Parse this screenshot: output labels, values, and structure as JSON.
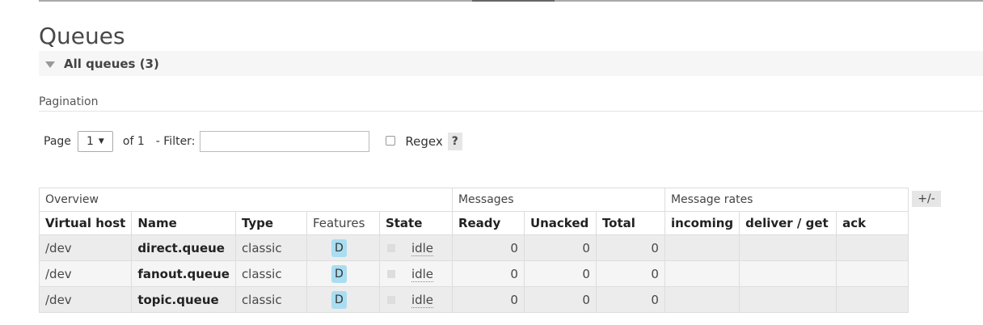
{
  "title": "Queues",
  "section": {
    "label": "All queues (3)"
  },
  "pagination": {
    "label": "Pagination",
    "page_label": "Page",
    "page_value": "1",
    "of_label": "of 1",
    "filter_label": "- Filter:",
    "filter_value": "",
    "regex_label": "Regex",
    "help_label": "?"
  },
  "table": {
    "groups": [
      "Overview",
      "Messages",
      "Message rates"
    ],
    "columns": [
      "Virtual host",
      "Name",
      "Type",
      "Features",
      "State",
      "Ready",
      "Unacked",
      "Total",
      "incoming",
      "deliver / get",
      "ack"
    ],
    "rows": [
      {
        "vhost": "/dev",
        "name": "direct.queue",
        "type": "classic",
        "feature": "D",
        "state": "idle",
        "ready": "0",
        "unacked": "0",
        "total": "0",
        "incoming": "",
        "deliver_get": "",
        "ack": ""
      },
      {
        "vhost": "/dev",
        "name": "fanout.queue",
        "type": "classic",
        "feature": "D",
        "state": "idle",
        "ready": "0",
        "unacked": "0",
        "total": "0",
        "incoming": "",
        "deliver_get": "",
        "ack": ""
      },
      {
        "vhost": "/dev",
        "name": "topic.queue",
        "type": "classic",
        "feature": "D",
        "state": "idle",
        "ready": "0",
        "unacked": "0",
        "total": "0",
        "incoming": "",
        "deliver_get": "",
        "ack": ""
      }
    ],
    "toggle_columns_label": "+/-"
  }
}
